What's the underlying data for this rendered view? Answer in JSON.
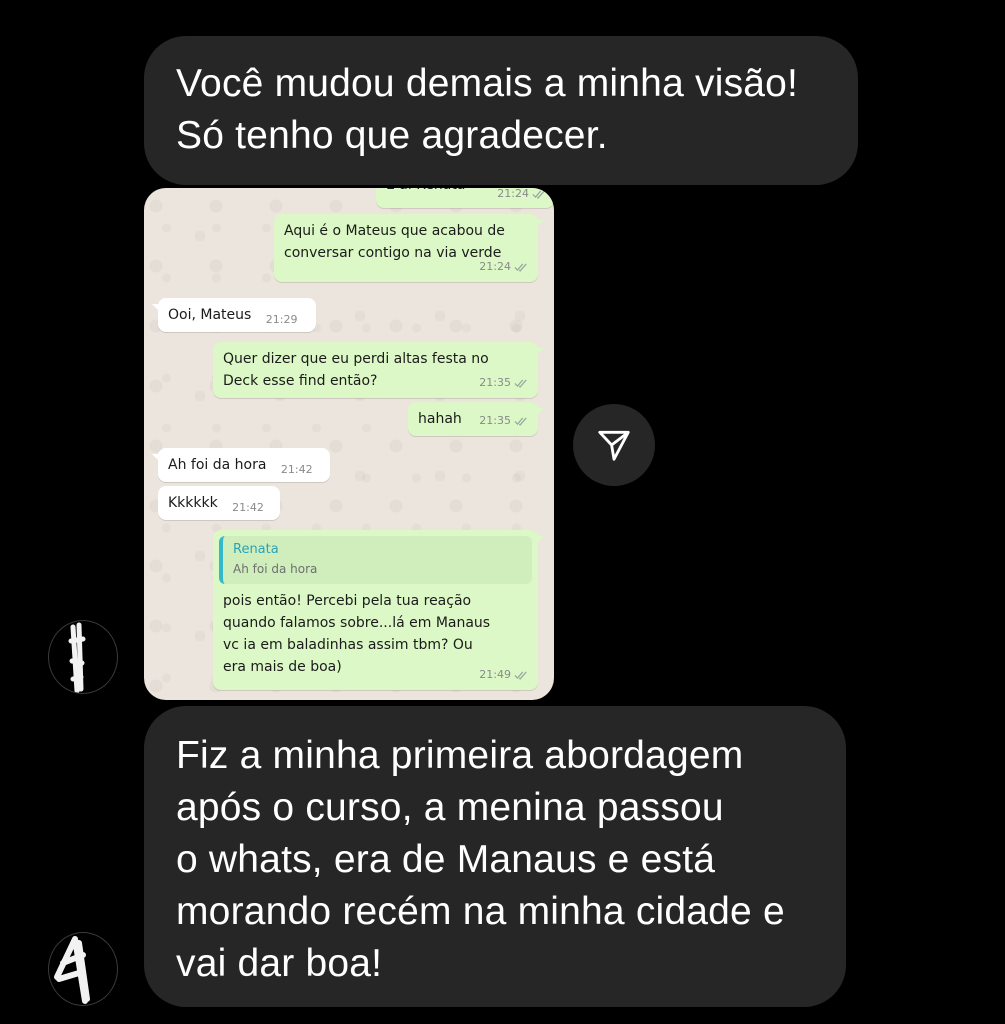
{
  "messages": {
    "top": "Você mudou demais a minha visão!\nSó tenho que agradecer.",
    "bottom": "Fiz a minha primeira abordagem\napós o curso, a menina passou\no whats, era de Manaus e está\nmorando recém na minha cidade e\nvai dar boa!"
  },
  "shared_chat": {
    "messages": [
      {
        "side": "out",
        "text": "E aí Renata",
        "time": "21:24"
      },
      {
        "side": "out",
        "text": "Aqui é o Mateus que acabou de conversar contigo na via verde",
        "time": "21:24"
      },
      {
        "side": "in",
        "text": "Ooi, Mateus",
        "time": "21:29"
      },
      {
        "side": "out",
        "text": "Quer dizer que eu perdi altas festa no Deck esse find então?",
        "time": "21:35"
      },
      {
        "side": "out",
        "text": "hahah",
        "time": "21:35"
      },
      {
        "side": "in",
        "text": "Ah foi da hora",
        "time": "21:42"
      },
      {
        "side": "in",
        "text": "Kkkkkk",
        "time": "21:42"
      },
      {
        "side": "out",
        "quote_author": "Renata",
        "quote_text": "Ah foi da hora",
        "text": "pois então! Percebi pela tua reação quando falamos sobre...lá em Manaus vc ia em baladinhas assim tbm? Ou era mais de boa)",
        "time": "21:49"
      }
    ]
  },
  "icons": {
    "share": "paper-plane-icon",
    "read_receipt": "double-check-icon"
  },
  "colors": {
    "background": "#000000",
    "dm_bubble": "#262626",
    "wa_incoming": "#ffffff",
    "wa_outgoing": "#dcf8c6",
    "wa_quote_accent": "#35b8c9"
  }
}
